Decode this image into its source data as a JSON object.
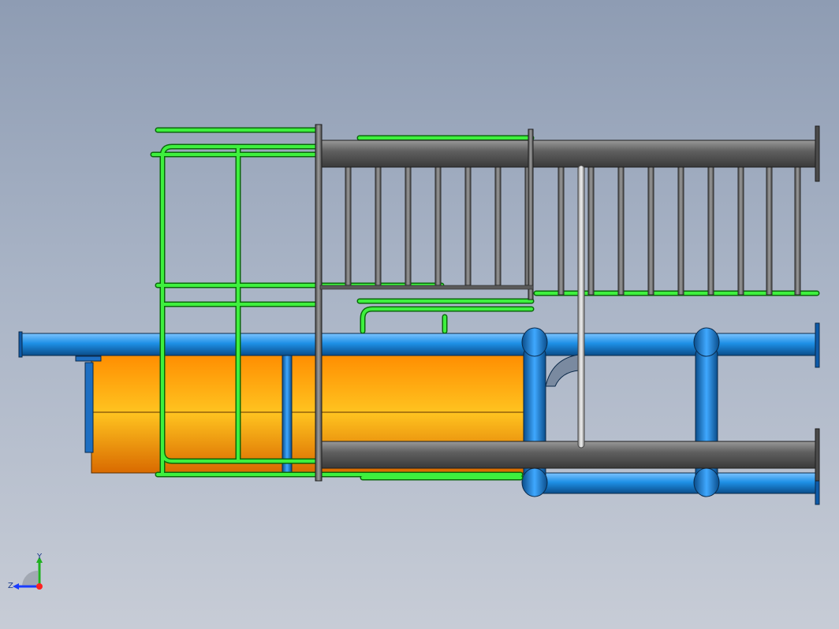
{
  "viewport": {
    "background_top": "#8e9cb3",
    "background_bottom": "#c7ccd6"
  },
  "colors": {
    "green_rail": "#22e022",
    "blue_pipe": "#1e90e6",
    "gray_beam": "#6e6e6e",
    "orange_tank": "#ffa500",
    "silver_rod": "#d0d0d0"
  },
  "model": {
    "parts": [
      "green-handrail-frame",
      "gray-ladder-beams",
      "ladder-rungs",
      "blue-pipe-loop",
      "orange-cylinder-tank",
      "vertical-rod"
    ]
  },
  "triad": {
    "y_label": "Y",
    "z_label": "Z",
    "icon": "coordinate-triad-icon"
  }
}
